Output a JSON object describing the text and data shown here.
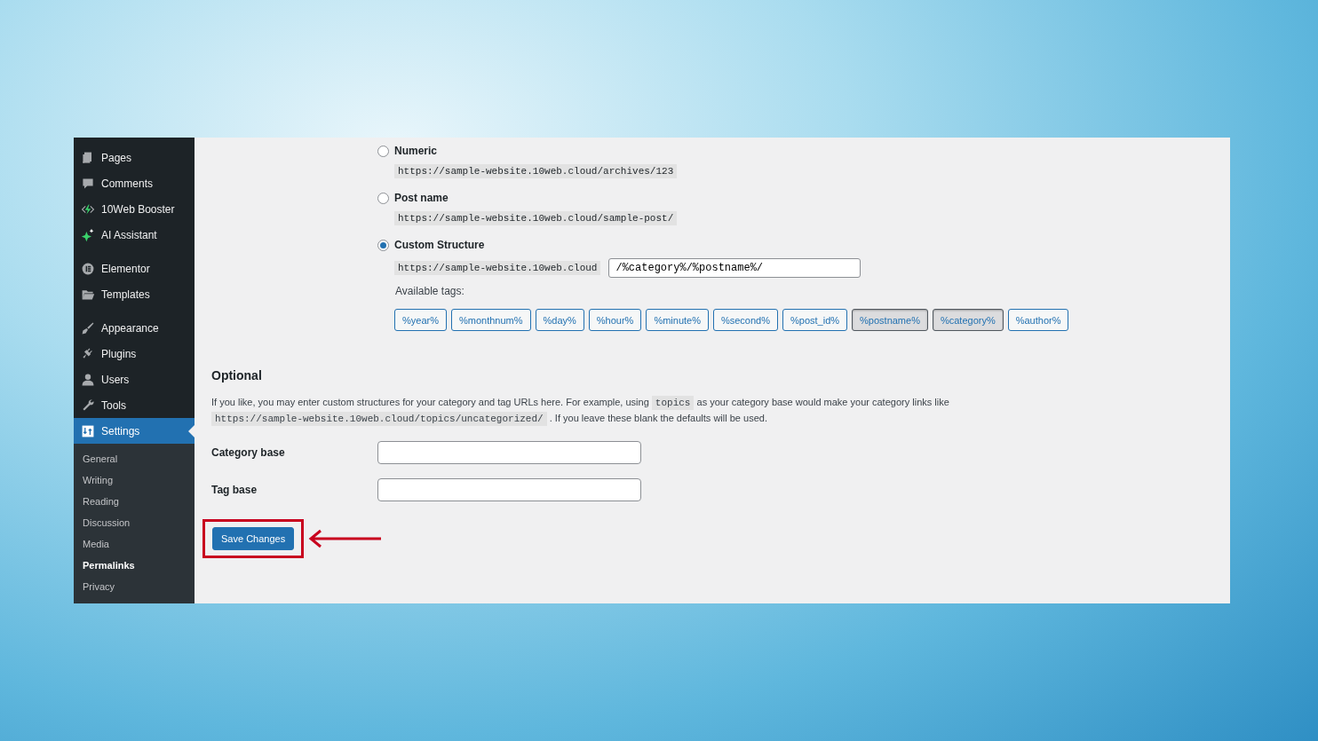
{
  "sidebar": {
    "items": [
      {
        "label": "Pages",
        "selected": false
      },
      {
        "label": "Comments",
        "selected": false
      },
      {
        "label": "10Web Booster",
        "selected": false
      },
      {
        "label": "AI Assistant",
        "selected": false
      },
      {
        "label": "Elementor",
        "selected": false
      },
      {
        "label": "Templates",
        "selected": false
      },
      {
        "label": "Appearance",
        "selected": false
      },
      {
        "label": "Plugins",
        "selected": false
      },
      {
        "label": "Users",
        "selected": false
      },
      {
        "label": "Tools",
        "selected": false
      },
      {
        "label": "Settings",
        "selected": true
      }
    ],
    "submenu": [
      {
        "label": "General",
        "selected": false
      },
      {
        "label": "Writing",
        "selected": false
      },
      {
        "label": "Reading",
        "selected": false
      },
      {
        "label": "Discussion",
        "selected": false
      },
      {
        "label": "Media",
        "selected": false
      },
      {
        "label": "Permalinks",
        "selected": true
      },
      {
        "label": "Privacy",
        "selected": false
      }
    ]
  },
  "structures": [
    {
      "label": "Numeric",
      "selected": false,
      "kind": "example",
      "example": "https://sample-website.10web.cloud/archives/123"
    },
    {
      "label": "Post name",
      "selected": false,
      "kind": "example",
      "example": "https://sample-website.10web.cloud/sample-post/"
    },
    {
      "label": "Custom Structure",
      "selected": true,
      "kind": "custom",
      "prefix": "https://sample-website.10web.cloud",
      "value": "/%category%/%postname%/"
    }
  ],
  "available_tags": {
    "label": "Available tags:",
    "tags": [
      {
        "label": "%year%",
        "selected": false
      },
      {
        "label": "%monthnum%",
        "selected": false
      },
      {
        "label": "%day%",
        "selected": false
      },
      {
        "label": "%hour%",
        "selected": false
      },
      {
        "label": "%minute%",
        "selected": false
      },
      {
        "label": "%second%",
        "selected": false
      },
      {
        "label": "%post_id%",
        "selected": false
      },
      {
        "label": "%postname%",
        "selected": true
      },
      {
        "label": "%category%",
        "selected": true
      },
      {
        "label": "%author%",
        "selected": false
      }
    ]
  },
  "optional": {
    "heading": "Optional",
    "description": [
      {
        "kind": "text",
        "text": "If you like, you may enter custom structures for your category and tag URLs here. For example, using "
      },
      {
        "kind": "code",
        "text": "topics"
      },
      {
        "kind": "text",
        "text": " as your category base would make your category links like "
      },
      {
        "kind": "code",
        "text": "https://sample-website.10web.cloud/topics/uncategorized/"
      },
      {
        "kind": "text",
        "text": " . If you leave these blank the defaults will be used."
      }
    ],
    "fields": [
      {
        "label": "Category base"
      },
      {
        "label": "Tag base"
      }
    ]
  },
  "save_button": "Save Changes"
}
